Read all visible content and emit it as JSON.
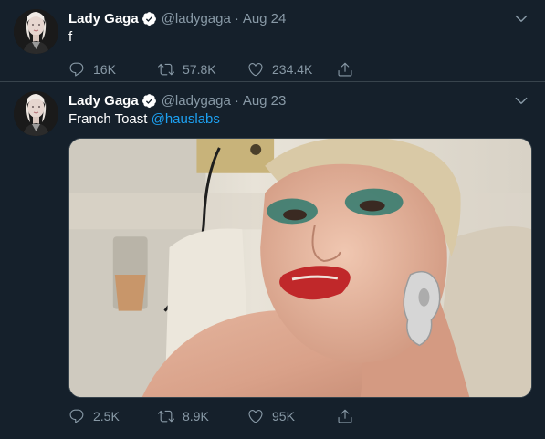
{
  "tweets": [
    {
      "name": "Lady Gaga",
      "handle": "@ladygaga",
      "separator": "·",
      "date": "Aug 24",
      "text": "f",
      "mention": "",
      "replies": "16K",
      "retweets": "57.8K",
      "likes": "234.4K"
    },
    {
      "name": "Lady Gaga",
      "handle": "@ladygaga",
      "separator": "·",
      "date": "Aug 23",
      "text": "Franch Toast ",
      "mention": "@hauslabs",
      "replies": "2.5K",
      "retweets": "8.9K",
      "likes": "95K"
    }
  ],
  "colors": {
    "background": "#15202b",
    "secondary_text": "#8899a6",
    "accent": "#1da1f2",
    "divider": "#38444d"
  },
  "icons": [
    "verified-badge-icon",
    "chevron-down-icon",
    "reply-icon",
    "retweet-icon",
    "like-icon",
    "share-icon"
  ]
}
